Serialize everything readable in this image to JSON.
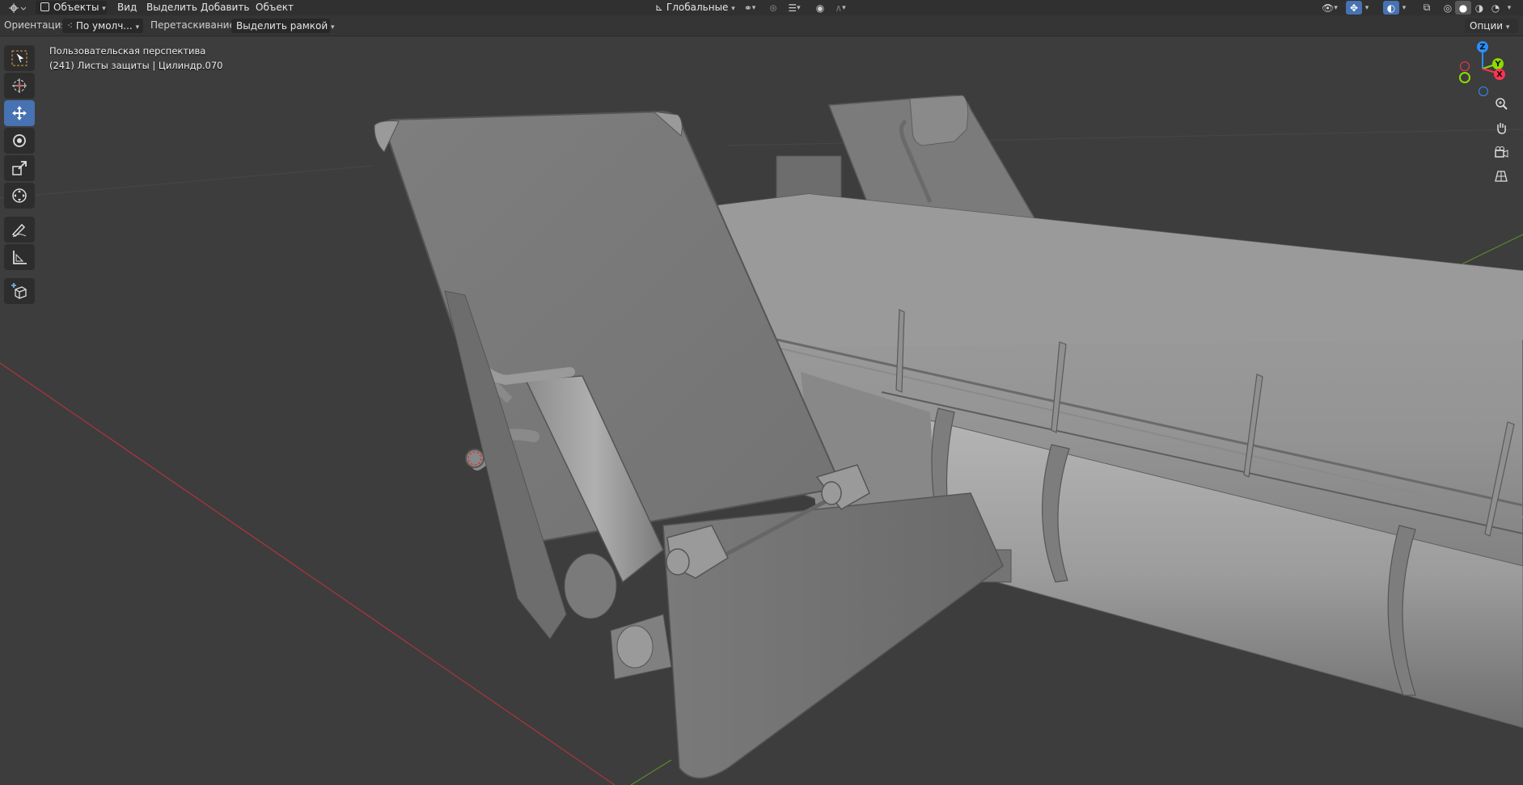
{
  "header": {
    "mode_label": "Объекты",
    "menus": [
      "Вид",
      "Выделить",
      "Добавить",
      "Объект"
    ],
    "transform_orientation": "Глобальные"
  },
  "tool_settings": {
    "orientation_label": "Ориентация:",
    "orientation_value": "По умолч...",
    "drag_label": "Перетаскивание:",
    "drag_value": "Выделить рамкой",
    "options_label": "Опции"
  },
  "viewport": {
    "view_name": "Пользовательская перспектива",
    "object_info": "(241) Листы защиты | Цилиндр.070",
    "gizmo": {
      "x": "X",
      "y": "Y",
      "z": "Z"
    }
  },
  "toolbar": {
    "tools": [
      "select-box",
      "cursor",
      "move",
      "rotate",
      "scale",
      "transform",
      "annotate",
      "measure",
      "add-cube"
    ],
    "active_tool": "move"
  },
  "colors": {
    "header_bg": "#303030",
    "viewport_bg": "#3d3d3d",
    "active_blue": "#4772b3",
    "axis_x": "#ff3352",
    "axis_y": "#8bdc00",
    "axis_z": "#2890ff",
    "model_gray": "#8a8a8a"
  }
}
